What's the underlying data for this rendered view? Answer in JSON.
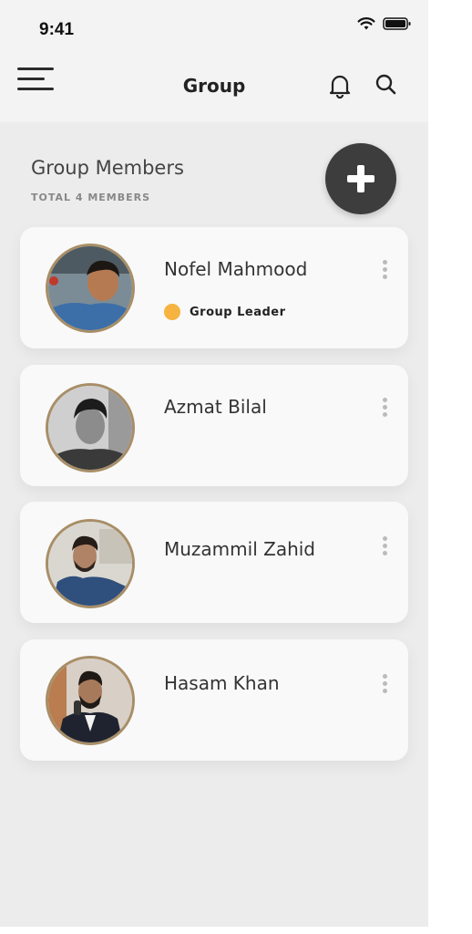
{
  "status_bar": {
    "time": "9:41",
    "icons": [
      "wifi-icon",
      "battery-icon"
    ]
  },
  "header": {
    "title": "Group",
    "icons": [
      "menu-icon",
      "bell-icon",
      "search-icon"
    ]
  },
  "section": {
    "title": "Group Members",
    "subtitle": "TOTAL 4 MEMBERS",
    "add_icon": "plus-icon"
  },
  "members": [
    {
      "name": "Nofel Mahmood",
      "role": "Group Leader",
      "role_color": "#f6b33f"
    },
    {
      "name": "Azmat Bilal"
    },
    {
      "name": "Muzammil Zahid"
    },
    {
      "name": "Hasam Khan"
    }
  ],
  "colors": {
    "accent_dark": "#3d3d3d",
    "avatar_ring": "#a88e67",
    "background": "#ececec",
    "card": "#f9f9f9"
  }
}
